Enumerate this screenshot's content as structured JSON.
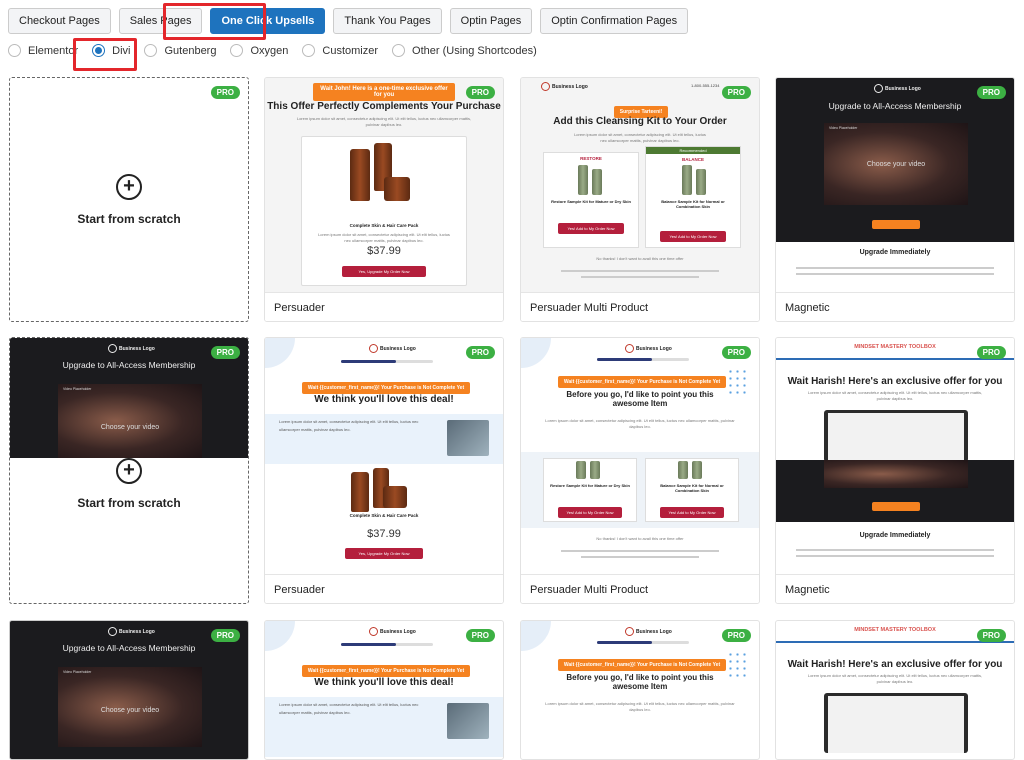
{
  "tabs": [
    "Checkout Pages",
    "Sales Pages",
    "One Click Upsells",
    "Thank You Pages",
    "Optin Pages",
    "Optin Confirmation Pages"
  ],
  "builders": [
    "Elementor",
    "Divi",
    "Gutenberg",
    "Oxygen",
    "Customizer",
    "Other (Using Shortcodes)"
  ],
  "pro_badge": "PRO",
  "scratch": {
    "label": "Start from scratch",
    "plus": "+"
  },
  "templates": {
    "persuader": "Persuader",
    "multi": "Persuader Multi Product",
    "magnetic": "Magnetic"
  },
  "preview": {
    "wait_john": "Wait John! Here is a one-time exclusive offer for you",
    "complements": "This Offer Perfectly Complements Your Purchase",
    "lorem_short": "Lorem ipsum dolor sit amet, consectetur adipiscing elit. Ut elit tellus, luctus nec ullamcorper mattis, pulvinar dapibus leo.",
    "kit": "Complete Skin & Hair Care Pack",
    "price": "$37.99",
    "yes_btn": "Yes, Upgrade My Order Now",
    "surprise": "Surprise Tarteeni!",
    "cleansing": "Add this Cleansing Kit to Your Order",
    "recommended": "Recommended",
    "restore": "RESTORE",
    "balance": "BALANCE",
    "restore_kit": "Restore Sample Kit for Mature or Dry Skin",
    "balance_kit": "Balance Sample Kit for Normal or Combination Skin",
    "add_btn": "Yes! Add to My Order Now",
    "upgrade_all": "Upgrade to All-Access Membership",
    "choose_video": "Choose your video",
    "video_title": "Video Placeholder",
    "upgrade_imm": "Upgrade Immediately",
    "business_logo": "Business Logo",
    "wait_customer": "Wait {{customer_first_name}}! Your Purchase is Not Complete Yet",
    "love_deal": "We think you'll love this deal!",
    "before_go": "Before you go, I'd like to point you this awesome Item",
    "mindset": "MINDSET MASTERY TOOLBOX",
    "wait_harish": "Wait Harish! Here's an exclusive offer for you",
    "no_thanks": "No thanks! I don't want to avail this one time offer",
    "phone": "1-800-555-1234"
  },
  "colors": {
    "accent": "#1e73be",
    "highlight": "#e3262b",
    "pro": "#3cb043",
    "orange": "#f58220",
    "red_button": "#b41f3c"
  }
}
